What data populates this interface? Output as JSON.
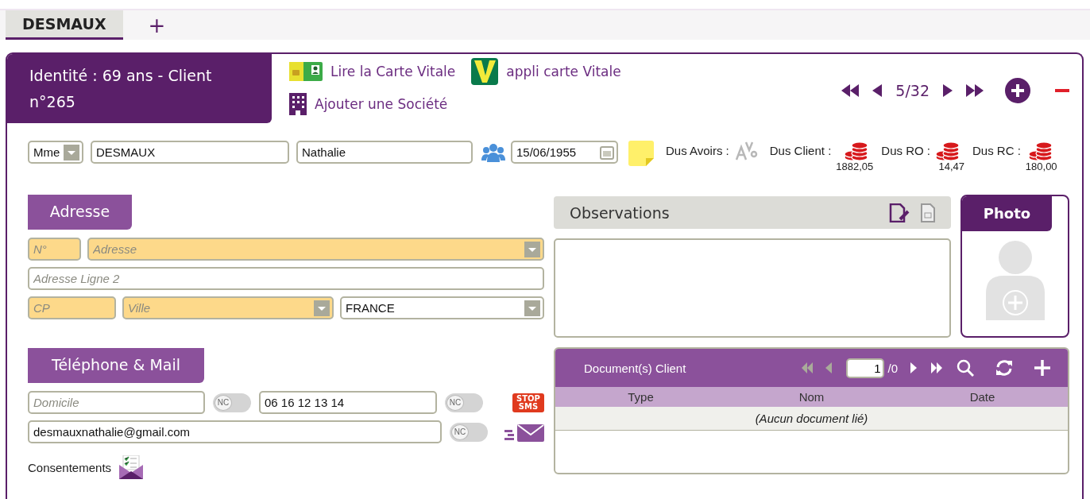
{
  "tabs": [
    {
      "label": "DESMAUX",
      "selected": true
    }
  ],
  "add_tab": "+",
  "identity": {
    "title": "Identité : 69 ans - Client n°265"
  },
  "actions": [
    {
      "kind": "vitale-card",
      "label": "Lire la Carte Vitale"
    },
    {
      "kind": "vitale-app",
      "label": "appli carte Vitale"
    },
    {
      "kind": "company",
      "label": "Ajouter une Société"
    }
  ],
  "pager": {
    "position": "5/32"
  },
  "person": {
    "civility": "Mme",
    "last_name": "DESMAUX",
    "first_name": "Nathalie",
    "birth_date": "15/06/1955"
  },
  "balances": [
    {
      "kind": "credit",
      "label": "Dus Avoirs :"
    },
    {
      "kind": "debt",
      "label": "Dus Client :",
      "amount": "1882,05"
    },
    {
      "kind": "debt",
      "label": "Dus RO :",
      "amount": "14,47"
    },
    {
      "kind": "debt",
      "label": "Dus RC :",
      "amount": "180,00"
    }
  ],
  "address": {
    "title": "Adresse",
    "rows": [
      {
        "fields": [
          {
            "kind": "text",
            "placeholder": "N°",
            "required": true
          },
          {
            "kind": "select",
            "placeholder": "Adresse",
            "required": true
          }
        ]
      },
      {
        "fields": [
          {
            "kind": "text",
            "placeholder": "Adresse Ligne 2",
            "required": false
          }
        ]
      },
      {
        "fields": [
          {
            "kind": "text",
            "placeholder": "CP",
            "required": true
          },
          {
            "kind": "select",
            "placeholder": "Ville",
            "required": true
          },
          {
            "kind": "select",
            "value": "FRANCE",
            "required": false
          }
        ]
      }
    ]
  },
  "contact": {
    "title": "Téléphone & Mail",
    "rows": [
      {
        "fields": [
          {
            "kind": "text",
            "placeholder": "Domicile",
            "required": false,
            "toggle": {
              "label": "NC",
              "on": false
            }
          },
          {
            "kind": "text",
            "value": "06 16 12 13 14",
            "required": false,
            "toggle": {
              "label": "NC",
              "on": false
            }
          }
        ],
        "extra": {
          "kind": "stop-sms",
          "label": "STOP SMS"
        }
      },
      {
        "fields": [
          {
            "kind": "text",
            "value": "desmauxnathalie@gmail.com",
            "required": false,
            "toggle": {
              "label": "NC",
              "on": false
            }
          }
        ],
        "extra": {
          "kind": "mail"
        }
      }
    ],
    "consent": "Consentements"
  },
  "observations": {
    "title": "Observations"
  },
  "photo": {
    "title": "Photo"
  },
  "documents": {
    "title": "Document(s) Client",
    "nav_before": [
      {
        "kind": "first",
        "disabled": true
      },
      {
        "kind": "prev",
        "disabled": true
      }
    ],
    "page": "1",
    "total": "/0",
    "nav_after": [
      {
        "kind": "next",
        "disabled": false
      },
      {
        "kind": "last",
        "disabled": false
      }
    ],
    "columns": [
      "Type",
      "Nom",
      "Date"
    ],
    "empty": "(Aucun document lié)"
  }
}
